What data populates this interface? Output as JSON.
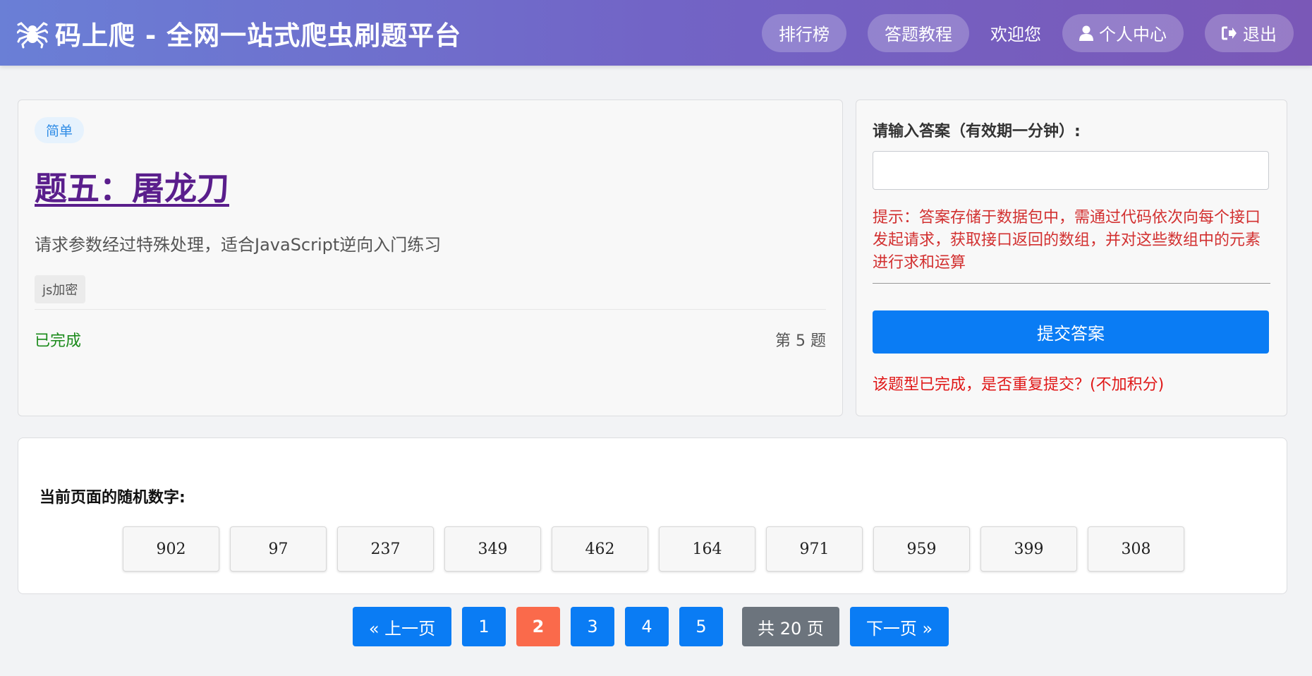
{
  "header": {
    "brand_title": "码上爬 - 全网一站式爬虫刷题平台",
    "nav": {
      "leaderboard": "排行榜",
      "tutorial": "答题教程",
      "welcome": "欢迎您",
      "profile": "个人中心",
      "logout": "退出"
    }
  },
  "question": {
    "difficulty": "简单",
    "title": "题五：屠龙刀",
    "description": "请求参数经过特殊处理，适合JavaScript逆向入门练习",
    "tag": "js加密",
    "status": "已完成",
    "number": "第 5 题"
  },
  "answer": {
    "label": "请输入答案（有效期一分钟）:",
    "input_value": "",
    "hint": "提示：答案存储于数据包中，需通过代码依次向每个接口发起请求，获取接口返回的数组，并对这些数组中的元素进行求和运算",
    "submit_label": "提交答案",
    "resubmit_notice": "该题型已完成，是否重复提交？(不加积分)"
  },
  "random_numbers": {
    "title": "当前页面的随机数字:",
    "values": [
      "902",
      "97",
      "237",
      "349",
      "462",
      "164",
      "971",
      "959",
      "399",
      "308"
    ]
  },
  "pagination": {
    "prev": "« 上一页",
    "pages": [
      "1",
      "2",
      "3",
      "4",
      "5"
    ],
    "current": "2",
    "total": "共 20 页",
    "next": "下一页 »"
  },
  "colors": {
    "header_gradient_start": "#6a7fd6",
    "header_gradient_end": "#7a58b7",
    "primary": "#0a7cf4",
    "active_page": "#fa6a4b",
    "hint_red": "#d23030",
    "done_green": "#1a8a1a"
  }
}
